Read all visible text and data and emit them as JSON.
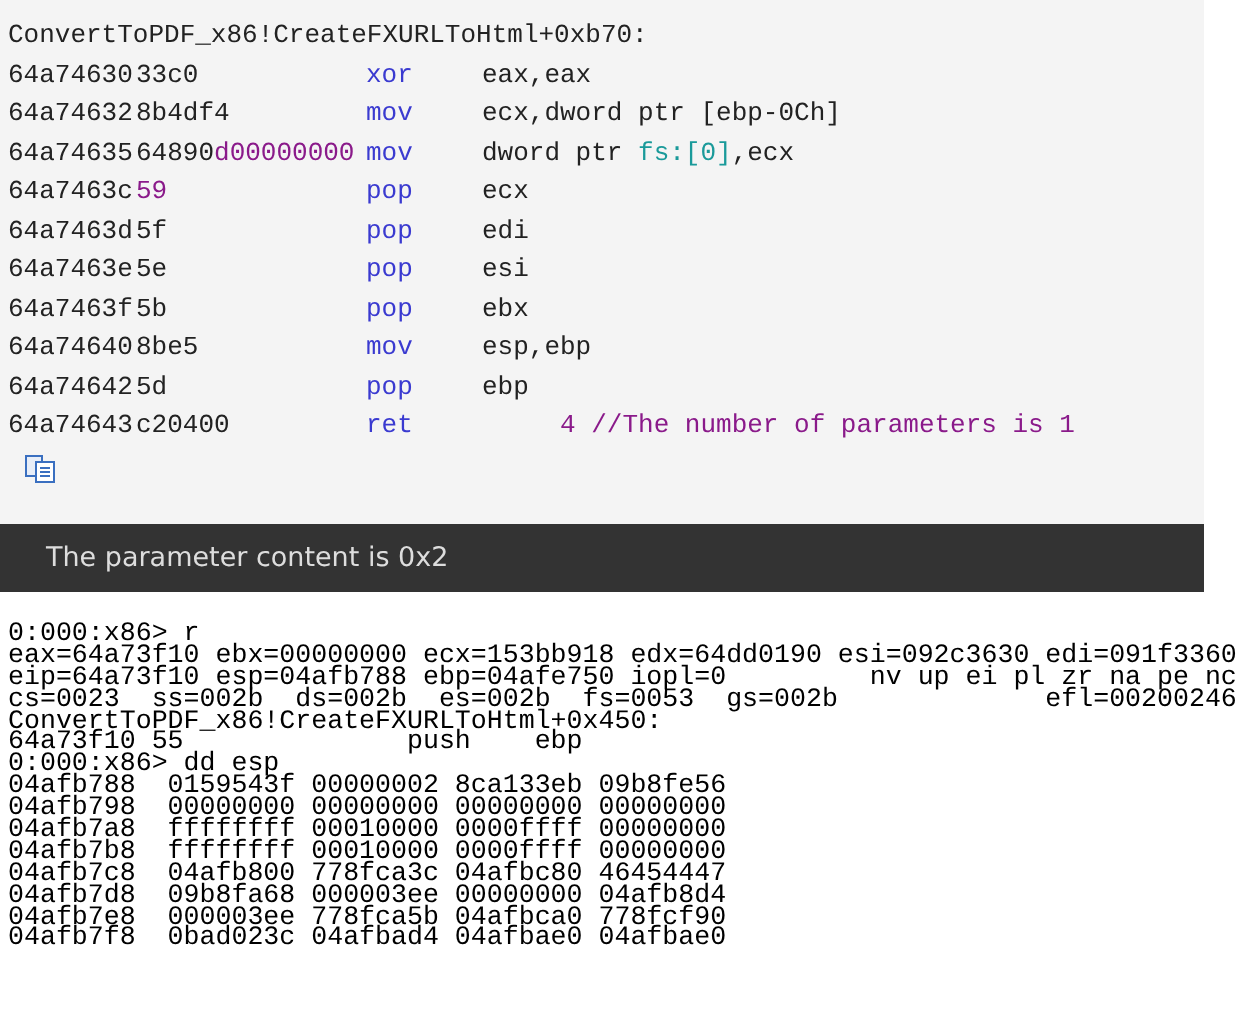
{
  "code_panel": {
    "header": "ConvertToPDF_x86!CreateFXURLToHtml+0xb70:",
    "lines": [
      {
        "address": "64a74630",
        "bytes": [
          {
            "text": "33c0",
            "kind": "plain"
          }
        ],
        "mnemonic": "xor",
        "operands": [
          {
            "text": "eax,eax",
            "kind": "plain"
          }
        ]
      },
      {
        "address": "64a74632",
        "bytes": [
          {
            "text": "8b4df4",
            "kind": "plain"
          }
        ],
        "mnemonic": "mov",
        "operands": [
          {
            "text": "ecx,dword ptr [ebp-0Ch]",
            "kind": "plain"
          }
        ]
      },
      {
        "address": "64a74635",
        "bytes": [
          {
            "text": "64890",
            "kind": "plain"
          },
          {
            "text": "d00000000",
            "kind": "number"
          }
        ],
        "mnemonic": "mov",
        "operands": [
          {
            "text": "dword ptr ",
            "kind": "plain"
          },
          {
            "text": "fs:",
            "kind": "segment"
          },
          {
            "text": "[0]",
            "kind": "segment"
          },
          {
            "text": ",ecx",
            "kind": "plain"
          }
        ]
      },
      {
        "address": "64a7463c",
        "bytes": [
          {
            "text": "59",
            "kind": "number"
          }
        ],
        "mnemonic": "pop",
        "operands": [
          {
            "text": "ecx",
            "kind": "plain"
          }
        ]
      },
      {
        "address": "64a7463d",
        "bytes": [
          {
            "text": "5f",
            "kind": "plain"
          }
        ],
        "mnemonic": "pop",
        "operands": [
          {
            "text": "edi",
            "kind": "plain"
          }
        ]
      },
      {
        "address": "64a7463e",
        "bytes": [
          {
            "text": "5e",
            "kind": "plain"
          }
        ],
        "mnemonic": "pop",
        "operands": [
          {
            "text": "esi",
            "kind": "plain"
          }
        ]
      },
      {
        "address": "64a7463f",
        "bytes": [
          {
            "text": "5b",
            "kind": "plain"
          }
        ],
        "mnemonic": "pop",
        "operands": [
          {
            "text": "ebx",
            "kind": "plain"
          }
        ]
      },
      {
        "address": "64a74640",
        "bytes": [
          {
            "text": "8be5",
            "kind": "plain"
          }
        ],
        "mnemonic": "mov",
        "operands": [
          {
            "text": "esp,ebp",
            "kind": "plain"
          }
        ]
      },
      {
        "address": "64a74642",
        "bytes": [
          {
            "text": "5d",
            "kind": "plain"
          }
        ],
        "mnemonic": "pop",
        "operands": [
          {
            "text": "ebp",
            "kind": "plain"
          }
        ]
      },
      {
        "address": "64a74643",
        "bytes": [
          {
            "text": "c20400",
            "kind": "plain"
          }
        ],
        "mnemonic": "ret",
        "operands": [
          {
            "text": "     4",
            "kind": "number"
          },
          {
            "text": " //The number of parameters is 1",
            "kind": "comment"
          }
        ]
      }
    ]
  },
  "caption": "The parameter content is 0x2",
  "console": {
    "lines": [
      "0:000:x86> r",
      "eax=64a73f10 ebx=00000000 ecx=153bb918 edx=64dd0190 esi=092c3630 edi=091f3360",
      "eip=64a73f10 esp=04afb788 ebp=04afe750 iopl=0         nv up ei pl zr na pe nc",
      "cs=0023  ss=002b  ds=002b  es=002b  fs=0053  gs=002b             efl=00200246",
      "ConvertToPDF_x86!CreateFXURLToHtml+0x450:",
      "64a73f10 55              push    ebp",
      "0:000:x86> dd esp",
      "04afb788  0159543f 00000002 8ca133eb 09b8fe56",
      "04afb798  00000000 00000000 00000000 00000000",
      "04afb7a8  ffffffff 00010000 0000ffff 00000000",
      "04afb7b8  ffffffff 00010000 0000ffff 00000000",
      "04afb7c8  04afb800 778fca3c 04afbc80 46454447",
      "04afb7d8  09b8fa68 000003ee 00000000 04afb8d4",
      "04afb7e8  000003ee 778fca5b 04afbca0 778fcf90",
      "04afb7f8  0bad023c 04afbad4 04afbae0 04afbae0"
    ]
  }
}
